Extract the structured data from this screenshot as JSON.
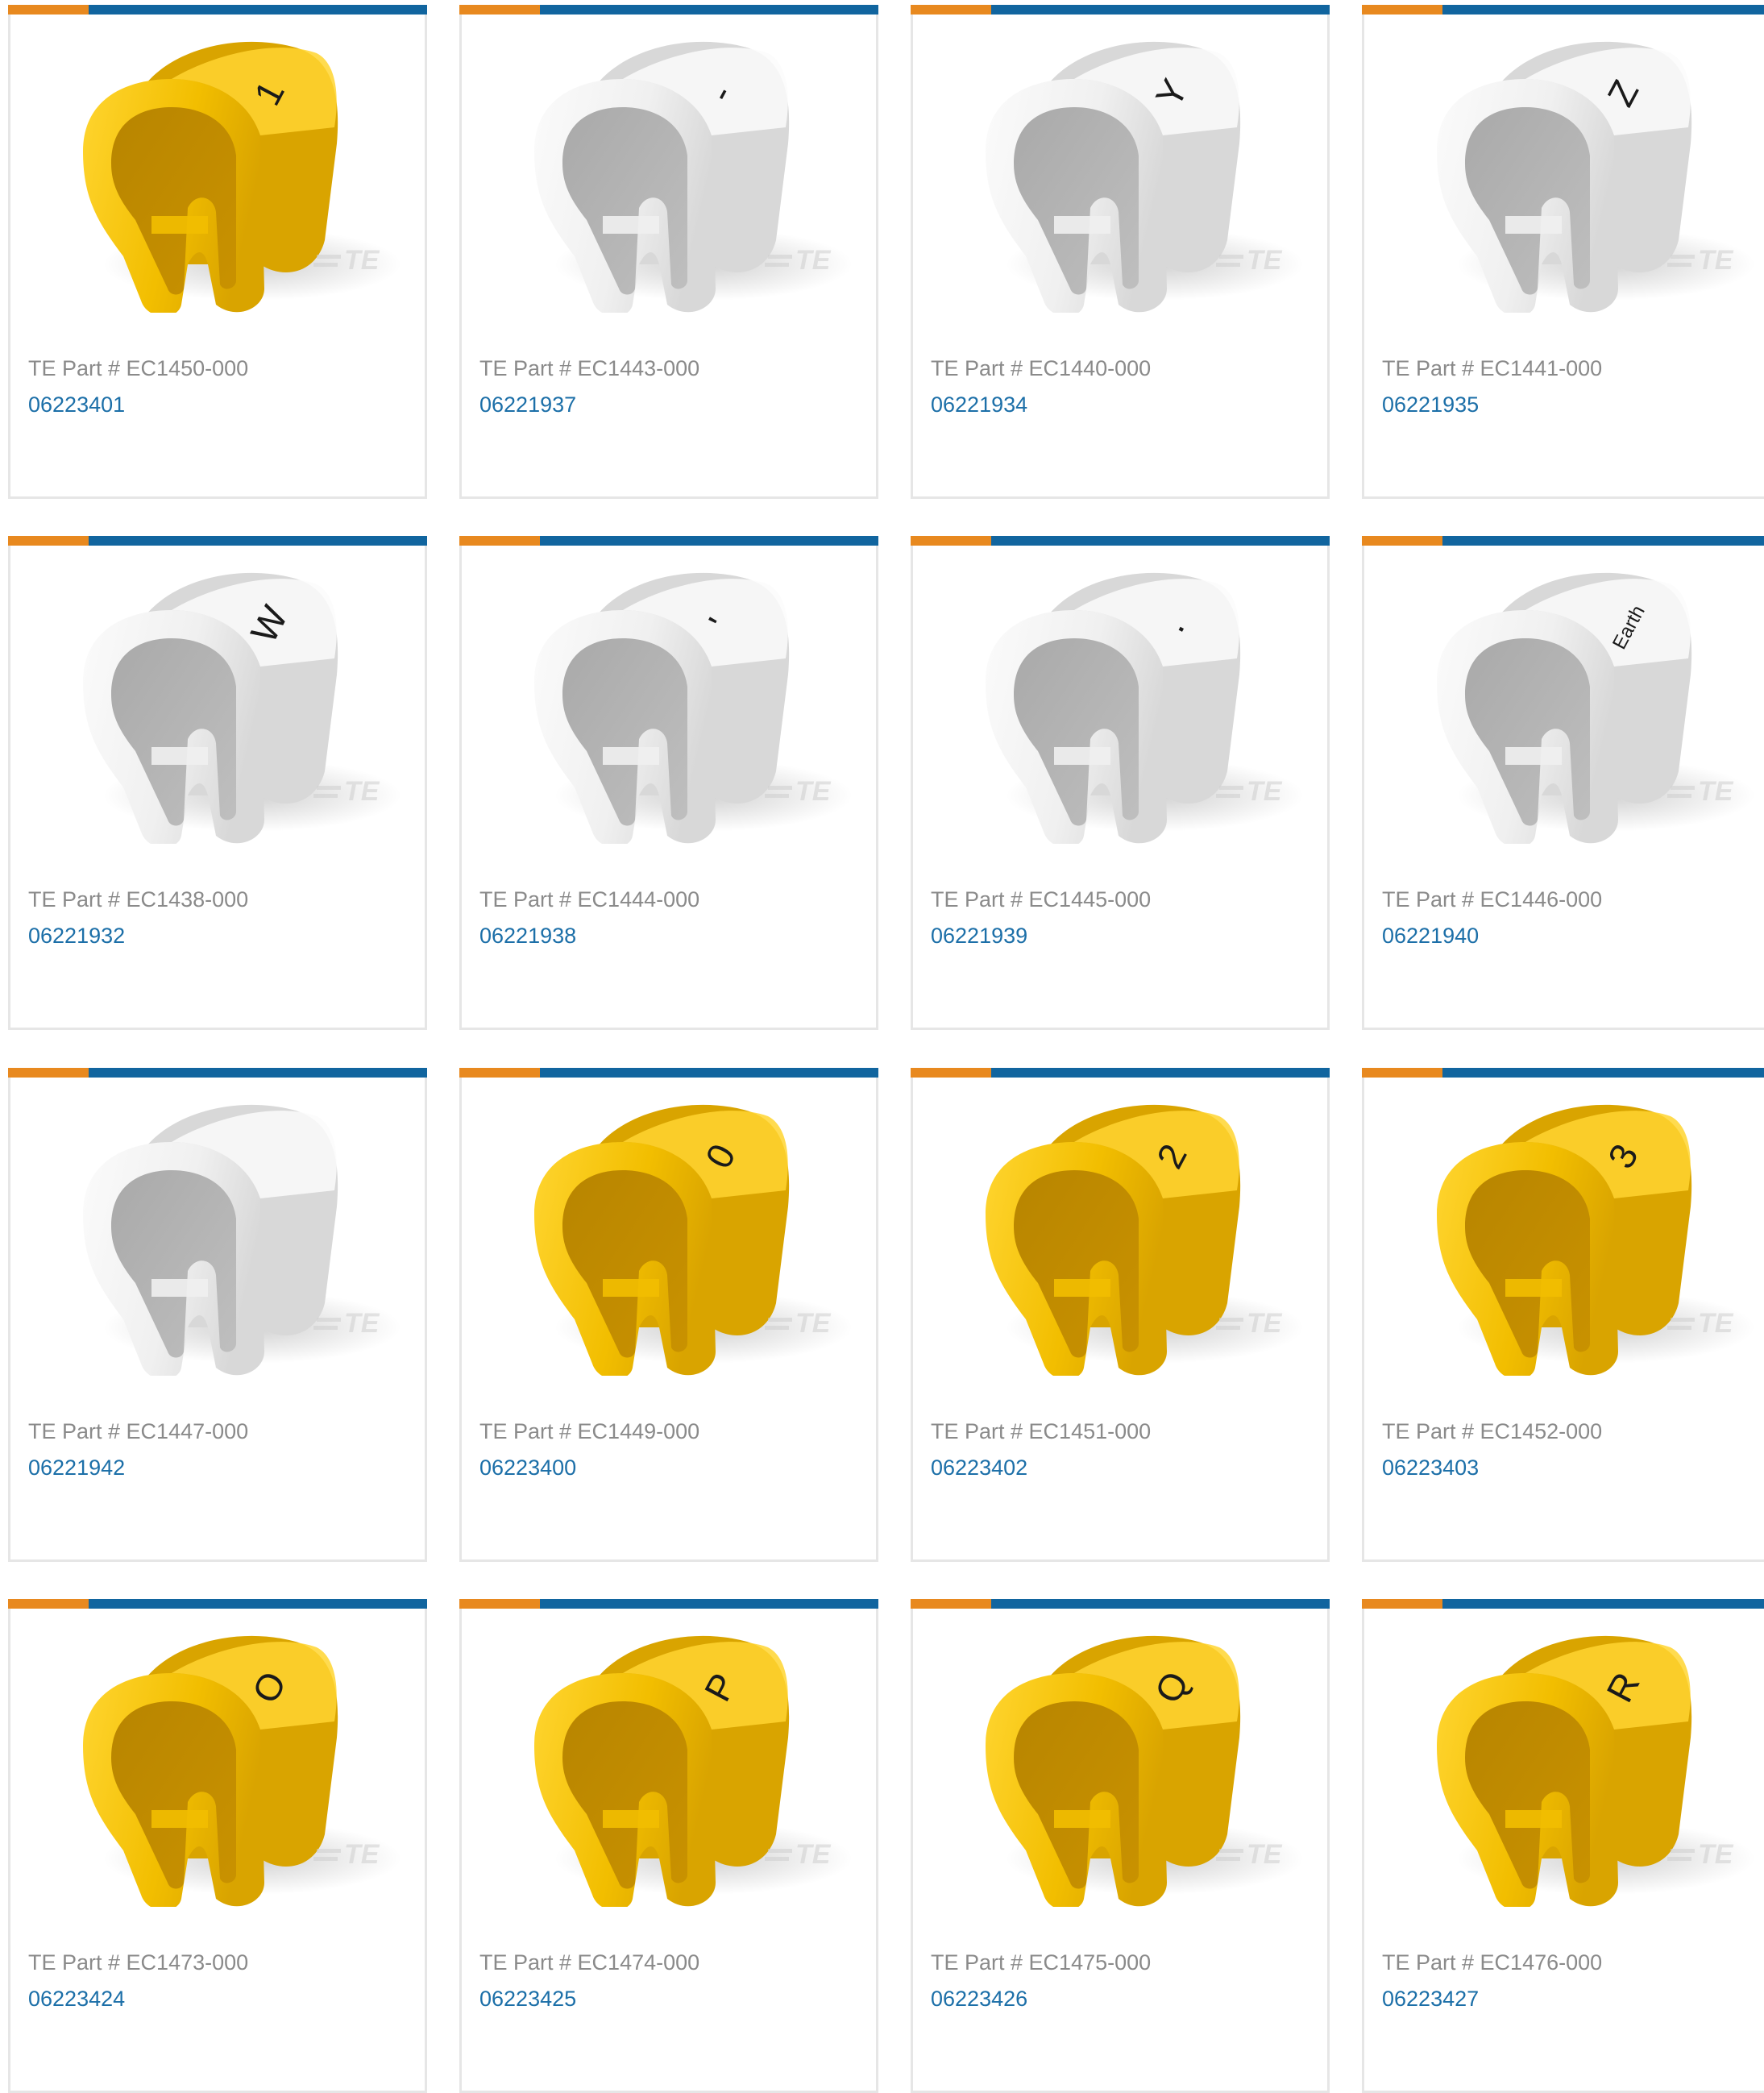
{
  "colors": {
    "accent_orange": "#e8891f",
    "accent_blue": "#11659f",
    "link": "#1c6fa8",
    "label": "#8a8a8a",
    "yellow_marker": "#f4c000",
    "white_marker": "#f1f1f1"
  },
  "watermark": "TE",
  "products": [
    {
      "part_label": "TE Part # EC1450-000",
      "catalog_number": "06223401",
      "color": "yellow",
      "legend": "1"
    },
    {
      "part_label": "TE Part # EC1443-000",
      "catalog_number": "06221937",
      "color": "white",
      "legend": "-"
    },
    {
      "part_label": "TE Part # EC1440-000",
      "catalog_number": "06221934",
      "color": "white",
      "legend": "Y"
    },
    {
      "part_label": "TE Part # EC1441-000",
      "catalog_number": "06221935",
      "color": "white",
      "legend": "Z"
    },
    {
      "part_label": "TE Part # EC1438-000",
      "catalog_number": "06221932",
      "color": "white",
      "legend": "W"
    },
    {
      "part_label": "TE Part # EC1444-000",
      "catalog_number": "06221938",
      "color": "white",
      "legend": "'"
    },
    {
      "part_label": "TE Part # EC1445-000",
      "catalog_number": "06221939",
      "color": "white",
      "legend": "."
    },
    {
      "part_label": "TE Part # EC1446-000",
      "catalog_number": "06221940",
      "color": "white",
      "legend": "Earth"
    },
    {
      "part_label": "TE Part # EC1447-000",
      "catalog_number": "06221942",
      "color": "white",
      "legend": ""
    },
    {
      "part_label": "TE Part # EC1449-000",
      "catalog_number": "06223400",
      "color": "yellow",
      "legend": "0"
    },
    {
      "part_label": "TE Part # EC1451-000",
      "catalog_number": "06223402",
      "color": "yellow",
      "legend": "2"
    },
    {
      "part_label": "TE Part # EC1452-000",
      "catalog_number": "06223403",
      "color": "yellow",
      "legend": "3"
    },
    {
      "part_label": "TE Part # EC1473-000",
      "catalog_number": "06223424",
      "color": "yellow",
      "legend": "O"
    },
    {
      "part_label": "TE Part # EC1474-000",
      "catalog_number": "06223425",
      "color": "yellow",
      "legend": "P"
    },
    {
      "part_label": "TE Part # EC1475-000",
      "catalog_number": "06223426",
      "color": "yellow",
      "legend": "Q"
    },
    {
      "part_label": "TE Part # EC1476-000",
      "catalog_number": "06223427",
      "color": "yellow",
      "legend": "R"
    }
  ]
}
